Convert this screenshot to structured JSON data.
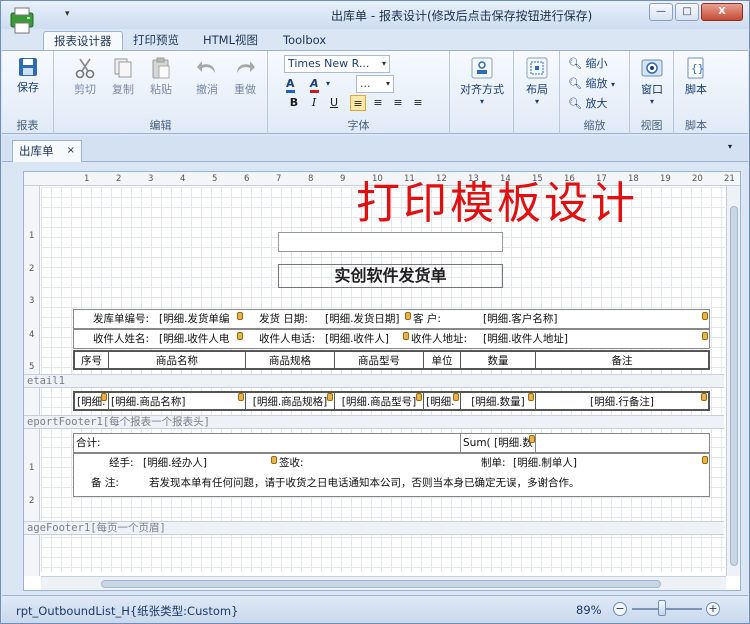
{
  "window": {
    "title": "出库单 - 报表设计(修改后点击保存按钮进行保存)",
    "quick_access_arrow": "▾",
    "btn_minimize": "—",
    "btn_maximize": "□",
    "btn_close": "X"
  },
  "tabs": [
    {
      "label": "报表设计器"
    },
    {
      "label": "打印预览"
    },
    {
      "label": "HTML视图"
    },
    {
      "label": "Toolbox"
    }
  ],
  "ribbon": {
    "report_group": {
      "label": "报表",
      "save": "保存"
    },
    "edit_group": {
      "label": "编辑",
      "cut": "剪切",
      "copy": "复制",
      "paste": "粘贴",
      "undo": "撤消",
      "redo": "重做"
    },
    "font_group": {
      "label": "字体",
      "font_name": "Times New R...",
      "font_size": "...",
      "dropdown_arrow": "▾"
    },
    "align_group": {
      "align": "对齐方式",
      "layout": "布局"
    },
    "zoom_group": {
      "label": "缩放",
      "zoom_out": "缩小",
      "zoom_mode": "缩放",
      "zoom_in": "放大"
    },
    "view_group": {
      "label": "视图",
      "window": "窗口"
    },
    "script_group": {
      "label": "脚本",
      "script": "脚本"
    }
  },
  "doc_tab": {
    "label": "出库单",
    "close": "×"
  },
  "watermark": "打印模板设计",
  "report": {
    "title": "实创软件发货单",
    "header_rows": [
      [
        {
          "label": "发库单编号:",
          "field": "[明细.发货单编"
        },
        {
          "label": "发货  日期:",
          "field": "[明细.发货日期]"
        },
        {
          "label": "客      户:",
          "field": "[明细.客户名称]"
        }
      ],
      [
        {
          "label": "收件人姓名:",
          "field": "[明细.收件人电"
        },
        {
          "label": "收件人电话:",
          "field": "[明细.收件人]"
        },
        {
          "label": "收件人地址:",
          "field": "[明细.收件人地址]"
        }
      ]
    ],
    "columns": [
      "序号",
      "商品名称",
      "商品规格",
      "商品型号",
      "单位",
      "数量",
      "备注"
    ],
    "detail_band": "etail1",
    "detail_fields": [
      "[明细.",
      "[明细.商品名称]",
      "[明细.商品规格]",
      "[明细.商品型号]",
      "[明细.",
      "[明细.数量]",
      "[明细.行备注]"
    ],
    "footer_band": "eportFooter1[每个报表一个报表头]",
    "total_label": "合计:",
    "sum_field": "Sum( [明细.数",
    "handler_label": "经手:",
    "handler_field": "[明细.经办人]",
    "sign_label": "签收:",
    "maker_label": "制单:",
    "maker_field": "[明细.制单人]",
    "note_label": "备    注:",
    "note_text": "若发现本单有任何问题，请于收货之日电话通知本公司，否则当本身已确定无误，多谢合作。",
    "page_footer_band": "ageFooter1[每页一个页眉]"
  },
  "ruler": {
    "top": [
      "1",
      "2",
      "3",
      "4",
      "5",
      "6",
      "7",
      "8",
      "9",
      "10",
      "11",
      "12",
      "13",
      "14",
      "15",
      "16",
      "17",
      "18",
      "19",
      "20",
      "21"
    ],
    "left_a": [
      "1",
      "2",
      "3",
      "4",
      "5"
    ],
    "left_b": [
      "1",
      "2"
    ]
  },
  "status": {
    "text": "rpt_OutboundList_H{纸张类型:Custom}",
    "zoom": "89%",
    "zoom_minus": "−",
    "zoom_plus": "+"
  }
}
